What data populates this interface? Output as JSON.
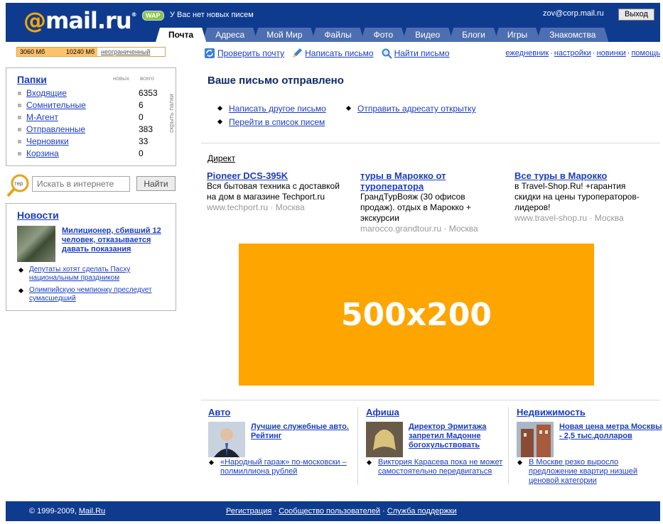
{
  "header": {
    "logo": {
      "at": "@",
      "text": "mail.ru",
      "reg": "®"
    },
    "wap_badge": "WAP",
    "no_new": "У Вас нет новых писем",
    "email": "zov@corp.mail.ru",
    "logout_label": "Выход",
    "tabs": [
      "Почта",
      "Адреса",
      "Мой Мир",
      "Файлы",
      "Фото",
      "Видео",
      "Блоги",
      "Игры",
      "Знакомства"
    ]
  },
  "quota": {
    "used": "3060 Мб",
    "total": "10240 Мб",
    "unlimited": "неограниченный"
  },
  "toolbar": {
    "check": "Проверить почту",
    "write": "Написать письмо",
    "find": "Найти письмо"
  },
  "toplinks": [
    "ежедневник",
    "настройки",
    "новинки",
    "помощь"
  ],
  "folders": {
    "title": "Папки",
    "col_new": "новых",
    "col_total": "всего",
    "hide": "скрыть папки",
    "items": [
      {
        "name": "Входящие",
        "count": "6353"
      },
      {
        "name": "Сомнительные",
        "count": "6"
      },
      {
        "name": "М-Агент",
        "count": "0"
      },
      {
        "name": "Отправленные",
        "count": "383"
      },
      {
        "name": "Черновики",
        "count": "33"
      },
      {
        "name": "Корзина",
        "count": "0"
      }
    ]
  },
  "search": {
    "placeholder": "Искать в интернете",
    "button": "Найти",
    "icon_text": "тер"
  },
  "news": {
    "title": "Новости",
    "headline": "Милиционер, сбивший 12 человек, отказывается давать показания",
    "items": [
      "Депутаты хотят сделать Пасху национальным праздником",
      "Олимпийскую чемпионку преследует сумасшедший"
    ]
  },
  "main": {
    "sent_title": "Ваше письмо  отправлено",
    "link_write_other": "Написать другое письмо",
    "link_postcard": "Отправить адресату открытку",
    "link_list": "Перейти в список писем"
  },
  "direct": {
    "label": "Директ",
    "ads": [
      {
        "title": "Pioneer DCS-395K",
        "desc": "Вся бытовая техника с доставкой на дом в магазине Techport.ru",
        "url": "www.techport.ru",
        "city": "Москва"
      },
      {
        "title": "туры в Марокко от туроператора",
        "desc": "ГрандТурВояж (30 офисов продаж). отдых в Марокко + экскурсии",
        "url": "marocco.grandtour.ru",
        "city": "Москва"
      },
      {
        "title": "Все туры в Марокко",
        "desc": "в Travel-Shop.Ru! +гарантия скидки на цены туроператоров-лидеров!",
        "url": "www.travel-shop.ru",
        "city": "Москва"
      }
    ]
  },
  "banner": "500x200",
  "columns": [
    {
      "title": "Авто",
      "headline": "Лучшие служебные авто. Рейтинг",
      "item": "«Народный гараж» по-московски – полмиллиона рублей"
    },
    {
      "title": "Афиша",
      "headline": "Директор Эрмитажа запретил Мадонне богохульствовать",
      "item": "Виктория Карасева пока не может самостоятельно передвигаться"
    },
    {
      "title": "Недвижимость",
      "headline": "Новая цена метра Москвы - 2,5 тыс.долларов",
      "item": "В Москве резко выросло предложение квартир низшей ценовой категории"
    }
  ],
  "footer": {
    "copy": "© 1999-2009,",
    "brand": "Mail.Ru",
    "links": [
      "Регистрация",
      "Сообщество пользователей",
      "Служба поддержки"
    ]
  },
  "colors": {
    "header_bg": "#0f3b8f",
    "accent_orange": "#f7a600",
    "link": "#1a3dc1",
    "banner": "#ffa500"
  }
}
